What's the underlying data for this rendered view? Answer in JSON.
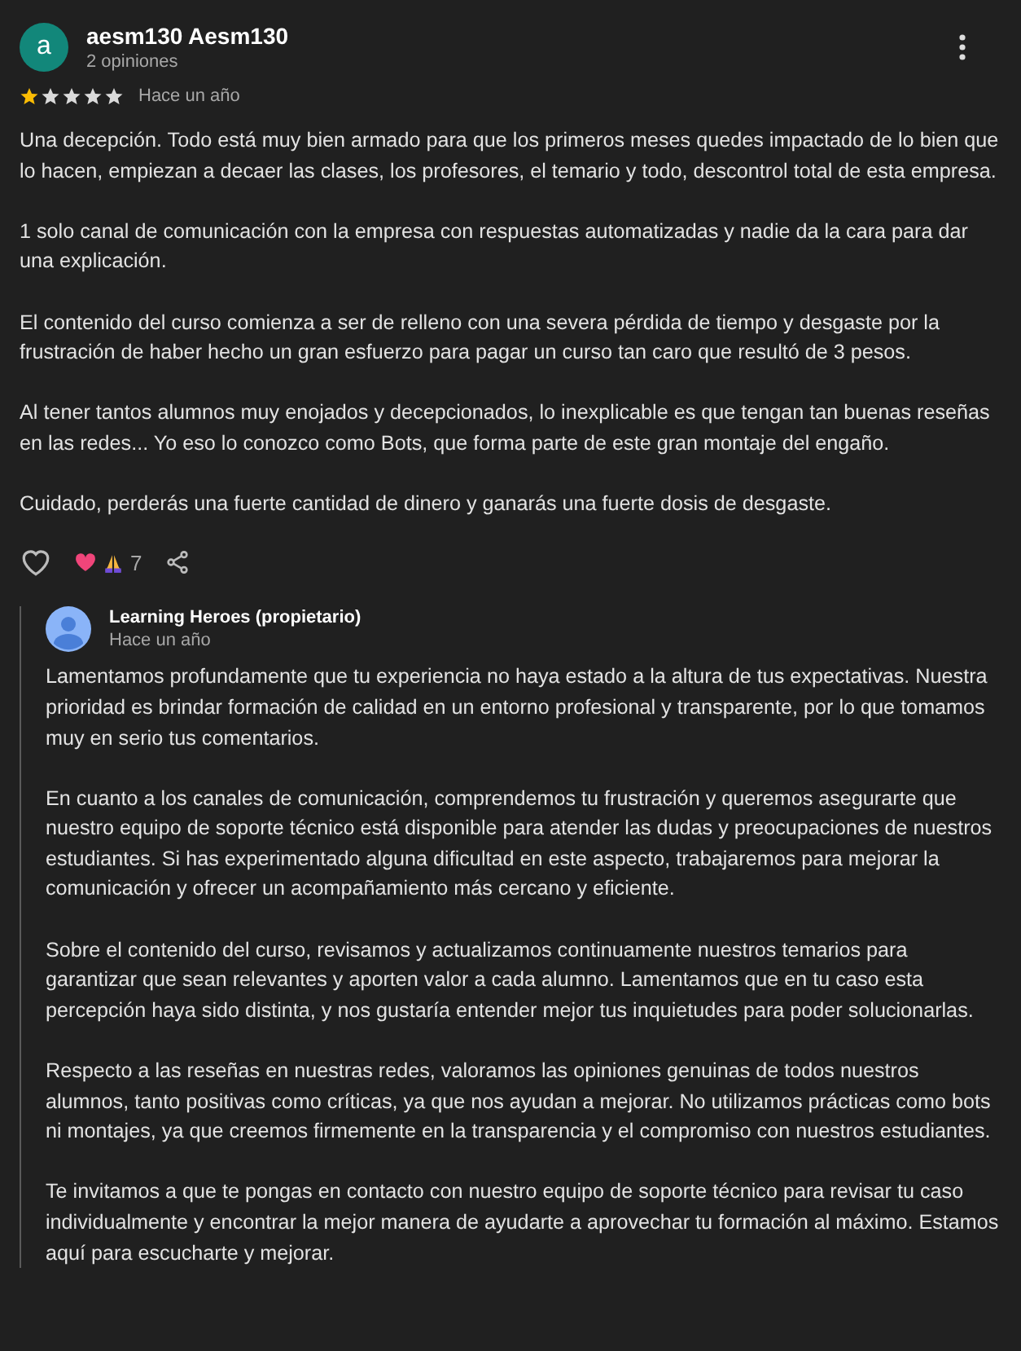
{
  "review": {
    "author": "aesm130 Aesm130",
    "avatar_letter": "a",
    "review_count": "2 opiniones",
    "stars": 1,
    "time": "Hace un año",
    "paragraphs": [
      "Una decepción. Todo está muy bien armado para que los primeros meses quedes impactado de lo bien que lo hacen, empiezan a decaer las clases, los profesores, el temario y todo, descontrol total de esta empresa.",
      "1 solo canal de comunicación con la empresa con respuestas automatizadas y nadie da la cara para dar una explicación.",
      "El contenido del curso comienza a ser de relleno con una severa pérdida de tiempo y desgaste por la frustración de haber hecho un gran esfuerzo para pagar un curso tan caro que resultó de 3 pesos.",
      "Al tener tantos alumnos muy enojados y decepcionados, lo inexplicable es que tengan tan buenas reseñas en las redes... Yo eso lo conozco como Bots, que forma parte de este gran montaje del engaño.",
      "Cuidado, perderás una fuerte cantidad de dinero y ganarás una fuerte dosis de desgaste."
    ],
    "liked": false,
    "reaction_count": "7"
  },
  "reply": {
    "author": "Learning Heroes (propietario)",
    "time": "Hace un año",
    "paragraphs": [
      "Lamentamos profundamente que tu experiencia no haya estado a la altura de tus expectativas. Nuestra prioridad es brindar formación de calidad en un entorno profesional y transparente, por lo que tomamos muy en serio tus comentarios.",
      "En cuanto a los canales de comunicación, comprendemos tu frustración y queremos asegurarte que nuestro equipo de soporte técnico está disponible para atender las dudas y preocupaciones de nuestros estudiantes. Si has experimentado alguna dificultad en este aspecto, trabajaremos para mejorar la comunicación y ofrecer un acompañamiento más cercano y eficiente.",
      "Sobre el contenido del curso, revisamos y actualizamos continuamente nuestros temarios para garantizar que sean relevantes y aporten valor a cada alumno. Lamentamos que en tu caso esta percepción haya sido distinta, y nos gustaría entender mejor tus inquietudes para poder solucionarlas.",
      "Respecto a las reseñas en nuestras redes, valoramos las opiniones genuinas de todos nuestros alumnos, tanto positivas como críticas, ya que nos ayudan a mejorar. No utilizamos prácticas como bots ni montajes, ya que creemos firmemente en la transparencia y el compromiso con nuestros estudiantes.",
      "Te invitamos a que te pongas en contacto con nuestro equipo de soporte técnico para revisar tu caso individualmente y encontrar la mejor manera de ayudarte a aprovechar tu formación al máximo. Estamos aquí para escucharte y mejorar."
    ]
  }
}
